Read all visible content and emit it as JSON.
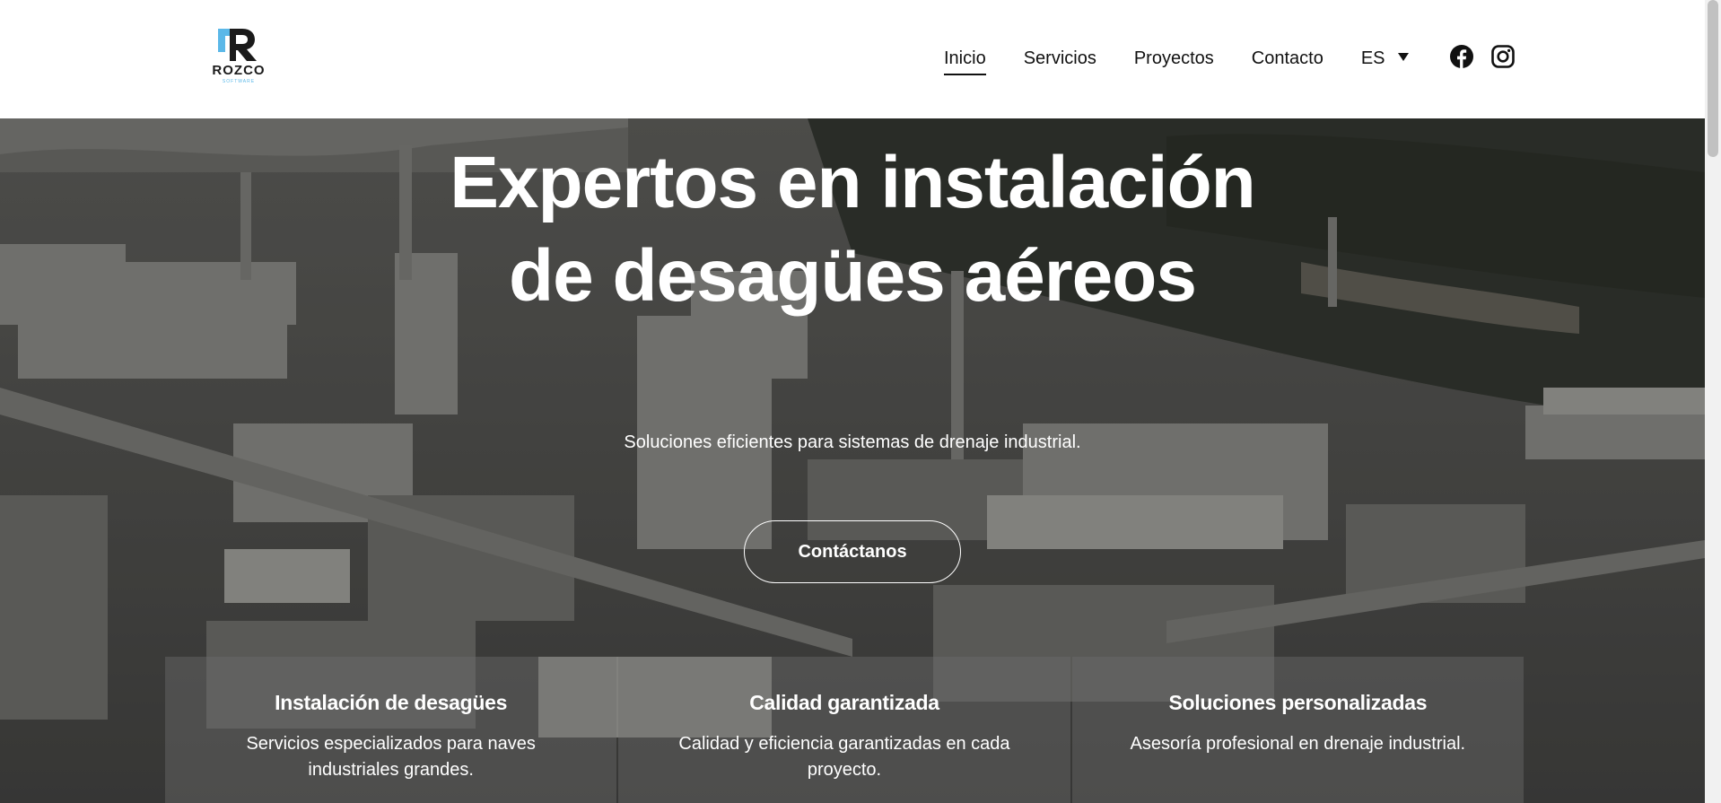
{
  "header": {
    "logo_text": "ROZCO",
    "logo_subtext": "SOFTWARE",
    "nav": [
      {
        "label": "Inicio",
        "active": true
      },
      {
        "label": "Servicios",
        "active": false
      },
      {
        "label": "Proyectos",
        "active": false
      },
      {
        "label": "Contacto",
        "active": false
      }
    ],
    "language": "ES",
    "social": [
      "facebook-icon",
      "instagram-icon"
    ]
  },
  "hero": {
    "title_line1": "Expertos en instalación",
    "title_line2": "de desagües aéreos",
    "subtitle": "Soluciones eficientes para sistemas de drenaje industrial.",
    "cta_label": "Contáctanos"
  },
  "cards": [
    {
      "title": "Instalación de desagües",
      "text": "Servicios especializados para naves industriales grandes."
    },
    {
      "title": "Calidad garantizada",
      "text": "Calidad y eficiencia garantizadas en cada proyecto."
    },
    {
      "title": "Soluciones personalizadas",
      "text": "Asesoría profesional en drenaje industrial."
    }
  ],
  "colors": {
    "logo_accent": "#5bb8e8",
    "text_dark": "#111111",
    "hero_text": "#ffffff"
  }
}
